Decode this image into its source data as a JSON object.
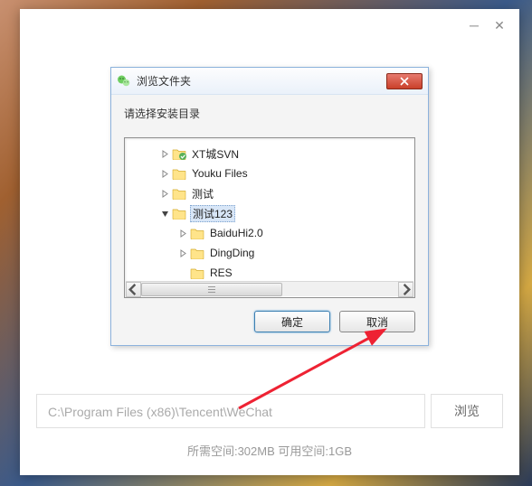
{
  "outer": {
    "path_value": "C:\\Program Files (x86)\\Tencent\\WeChat",
    "browse_label": "浏览",
    "space_info": "所需空间:302MB 可用空间:1GB"
  },
  "dialog": {
    "title": "浏览文件夹",
    "prompt": "请选择安装目录",
    "ok_label": "确定",
    "cancel_label": "取消"
  },
  "tree": {
    "items": [
      {
        "label": "XT城SVN",
        "indent": 36,
        "expander": "right",
        "overlay": "tortoise"
      },
      {
        "label": "Youku Files",
        "indent": 36,
        "expander": "right"
      },
      {
        "label": "测试",
        "indent": 36,
        "expander": "right"
      },
      {
        "label": "测试123",
        "indent": 36,
        "expander": "down",
        "selected": true
      },
      {
        "label": "BaiduHi2.0",
        "indent": 56,
        "expander": "right"
      },
      {
        "label": "DingDing",
        "indent": 56,
        "expander": "right"
      },
      {
        "label": "RES",
        "indent": 56,
        "expander": "none"
      }
    ]
  }
}
